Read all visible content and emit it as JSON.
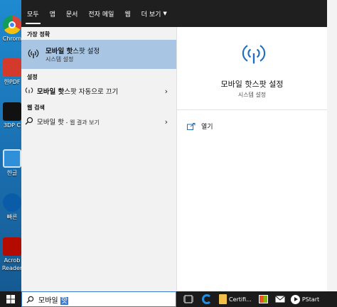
{
  "desktop": {
    "icons": [
      {
        "label": "Chrom"
      },
      {
        "label": "한PDF"
      },
      {
        "label": "3DP C"
      },
      {
        "label": "한글"
      },
      {
        "label": "빠른"
      },
      {
        "label": "Acrob"
      },
      {
        "label": "Reader"
      }
    ]
  },
  "nav": {
    "tabs": [
      {
        "label": "모두"
      },
      {
        "label": "앱"
      },
      {
        "label": "문서"
      },
      {
        "label": "전자 메일"
      },
      {
        "label": "웹"
      },
      {
        "label": "더 보기"
      }
    ],
    "more_caret": "▼"
  },
  "results": {
    "best_match_title": "가장 정확",
    "best": {
      "title_bold": "모바일 핫",
      "title_rest": "스팟 설정",
      "subtitle": "시스템 설정"
    },
    "settings_title": "설정",
    "settings_item": {
      "bold": "모바일 핫",
      "rest": "스팟 자동으로 끄기"
    },
    "web_title": "웹 검색",
    "web_item": {
      "text": "모바일 핫",
      "suffix": " - 웹 결과 보기"
    }
  },
  "preview": {
    "title": "모바일 핫스팟 설정",
    "subtitle": "시스템 설정",
    "open_label": "열기"
  },
  "taskbar": {
    "search_text": "모바일 ",
    "search_highlight": "핫",
    "certificate_label": "Certifi...",
    "pstart_label": "PStart"
  },
  "colors": {
    "accent": "#1f6fc0",
    "selected": "#a8c6e4",
    "nav_bg": "#1f1f1f"
  }
}
